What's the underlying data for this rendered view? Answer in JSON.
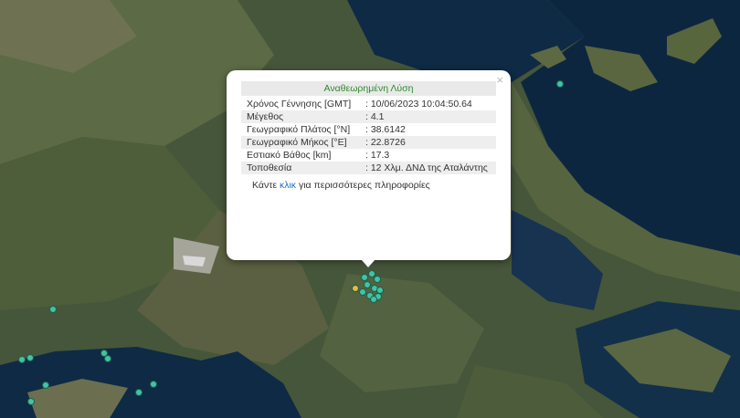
{
  "popup": {
    "title": "Αναθεωρημένη Λύση",
    "close": "×",
    "rows": [
      {
        "label": "Χρόνος Γέννησης [GMT]",
        "value": ": 10/06/2023 10:04:50.64"
      },
      {
        "label": "Μέγεθος",
        "value": ": 4.1"
      },
      {
        "label": "Γεωγραφικό Πλάτος [°N]",
        "value": ": 38.6142"
      },
      {
        "label": "Γεωγραφικό Μήκος [°E]",
        "value": ": 22.8726"
      },
      {
        "label": "Εστιακό Βάθος [km]",
        "value": ": 17.3"
      },
      {
        "label": "Τοποθεσία",
        "value": ": 12 Χλμ. ΔΝΔ της Αταλάντης"
      }
    ],
    "more_before": "Κάντε ",
    "more_link": "κλικ",
    "more_after": " για περισσότερες πληροφορίες"
  },
  "colors": {
    "marker_main": "#3fc4a4",
    "marker_latest": "#e8b93a",
    "title_text": "#2e8b30",
    "link": "#1a6fd4"
  }
}
